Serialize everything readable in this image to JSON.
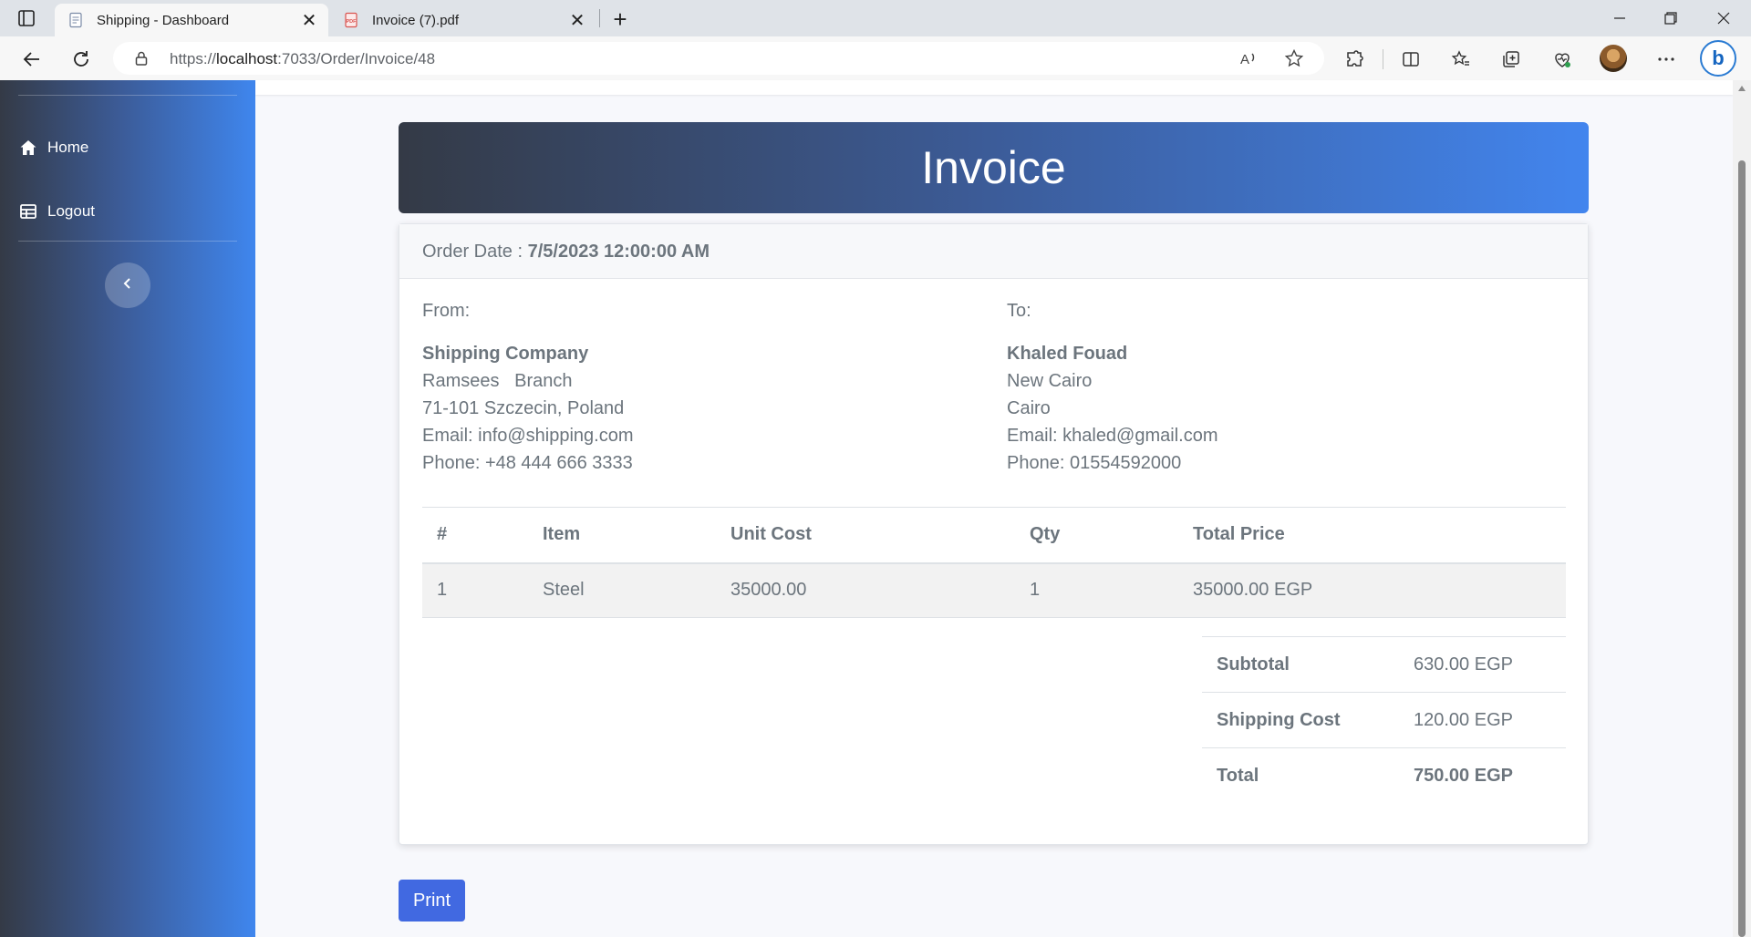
{
  "browser": {
    "tabs": [
      {
        "title": "Shipping - Dashboard",
        "icon": "page-icon",
        "active": true
      },
      {
        "title": "Invoice (7).pdf",
        "icon": "pdf-icon",
        "active": false
      }
    ],
    "address": {
      "prefix": "https://",
      "host": "localhost",
      "rest": ":7033/Order/Invoice/48"
    }
  },
  "sidebar": {
    "items": [
      {
        "label": "Home",
        "icon": "home-icon"
      },
      {
        "label": "Logout",
        "icon": "logout-icon"
      }
    ]
  },
  "invoice": {
    "title": "Invoice",
    "order_date_label": "Order Date :",
    "order_date": "7/5/2023 12:00:00 AM",
    "from": {
      "label": "From:",
      "name": "Shipping Company",
      "line1": "Ramsees   Branch",
      "line2": "71-101 Szczecin, Poland",
      "email": "Email: info@shipping.com",
      "phone": "Phone: +48 444 666 3333"
    },
    "to": {
      "label": "To:",
      "name": "Khaled Fouad",
      "line1": "New Cairo",
      "line2": "Cairo",
      "email": "Email: khaled@gmail.com",
      "phone": "Phone: 01554592000"
    },
    "table": {
      "headers": [
        "#",
        "Item",
        "Unit Cost",
        "Qty",
        "Total Price"
      ],
      "rows": [
        [
          "1",
          "Steel",
          "35000.00",
          "1",
          "35000.00 EGP"
        ]
      ]
    },
    "totals": [
      {
        "label": "Subtotal",
        "value": "630.00 EGP"
      },
      {
        "label": "Shipping Cost",
        "value": "120.00 EGP"
      },
      {
        "label": "Total",
        "value": "750.00 EGP"
      }
    ],
    "print_label": "Print"
  },
  "colors": {
    "accent": "#4169e1",
    "sidebar_start": "#343a46",
    "sidebar_end": "#3f86ee",
    "text_muted": "#6c757d"
  }
}
